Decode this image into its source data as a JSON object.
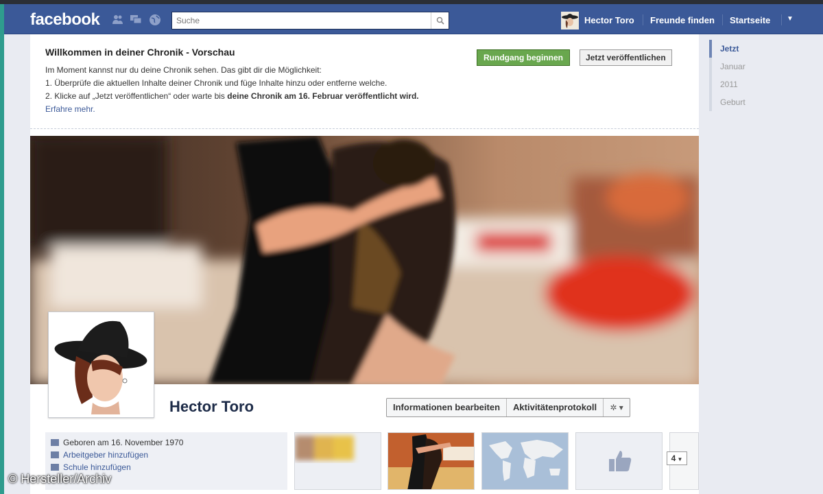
{
  "header": {
    "logo": "facebook",
    "search_placeholder": "Suche",
    "user_name": "Hector Toro",
    "friends_link": "Freunde finden",
    "home_link": "Startseite"
  },
  "preview_notice": {
    "title": "Willkommen in deiner Chronik - Vorschau",
    "line1": "Im Moment kannst nur du deine Chronik sehen. Das gibt dir die Möglichkeit:",
    "line2": "1. Überprüfe die aktuellen Inhalte deiner Chronik und füge Inhalte hinzu oder entferne welche.",
    "line3_start": "2. Klicke auf „Jetzt veröffentlichen“ oder warte bis ",
    "line3_bold": "deine Chronik am 16. Februar veröffentlicht wird.",
    "learn_more": "Erfahre mehr.",
    "tour_button": "Rundgang beginnen",
    "publish_button": "Jetzt veröffentlichen"
  },
  "profile": {
    "name": "Hector Toro",
    "edit_info": "Informationen bearbeiten",
    "activity_log": "Aktivitätenprotokoll",
    "born": "Geboren am 16. November 1970",
    "add_employer": "Arbeitgeber hinzufügen",
    "add_school": "Schule hinzufügen",
    "more_count": "4"
  },
  "timeline": [
    "Jetzt",
    "Januar",
    "2011",
    "Geburt"
  ],
  "watermark": "© Hersteller/Archiv",
  "colors": {
    "brand_blue": "#3b5998",
    "green_button": "#69a74e"
  },
  "icons": [
    "friends-icon",
    "messages-icon",
    "globe-icon",
    "search-icon",
    "gear-icon",
    "chevron-down-icon",
    "like-icon"
  ]
}
